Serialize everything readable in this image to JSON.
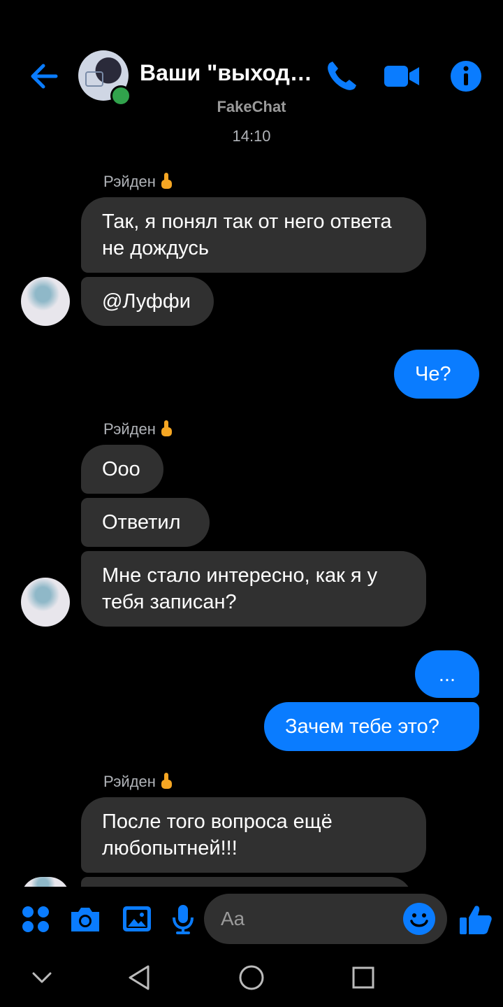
{
  "header": {
    "title": "Ваши \"выходн...",
    "app_name": "FakeChat",
    "time": "14:10"
  },
  "messages": [
    {
      "sender": "Рэйден",
      "sender_emoji": "middle-finger-emoji"
    },
    {
      "text": "Так, я понял так от него ответа не дождусь"
    },
    {
      "text": "@Луффи"
    },
    {
      "text": "Че?"
    },
    {
      "sender": "Рэйден",
      "sender_emoji": "middle-finger-emoji"
    },
    {
      "text": "Ооо"
    },
    {
      "text": "Ответил"
    },
    {
      "text": "Мне стало интересно, как я у тебя записан?"
    },
    {
      "text": "..."
    },
    {
      "text": "Зачем тебе это?"
    },
    {
      "sender": "Рэйден",
      "sender_emoji": "middle-finger-emoji"
    },
    {
      "text": "После того вопроса ещё любопытней!!!"
    }
  ],
  "composer": {
    "placeholder": "Aa",
    "icons": [
      "apps-icon",
      "camera-icon",
      "gallery-icon",
      "microphone-icon",
      "emoji-icon",
      "like-icon"
    ]
  },
  "colors": {
    "accent": "#0a7cff",
    "incoming_bubble": "#303030",
    "online": "#31a24c"
  }
}
